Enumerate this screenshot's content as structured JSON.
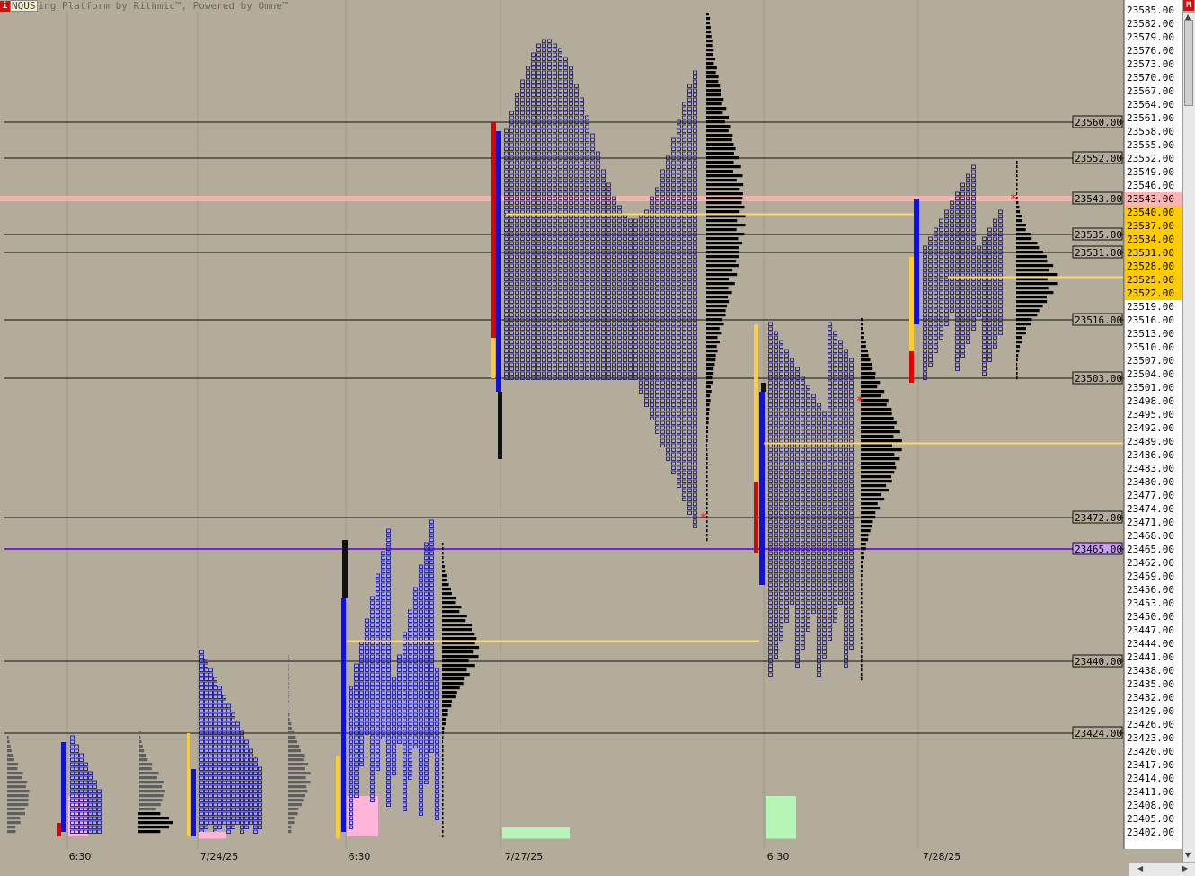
{
  "header": {
    "badge_left": "i",
    "symbol": "NQUS",
    "title": "ing Platform by Rithmic™, Powered by Omne™",
    "badge_right": "M"
  },
  "x_axis": [
    "6:30",
    "7/24/25",
    "6:30",
    "7/27/25",
    "6:30",
    "7/28/25"
  ],
  "price_ticks": [
    "23585.00",
    "23582.00",
    "23579.00",
    "23576.00",
    "23573.00",
    "23570.00",
    "23567.00",
    "23564.00",
    "23561.00",
    "23558.00",
    "23555.00",
    "23552.00",
    "23549.00",
    "23546.00",
    "23543.00",
    "23540.00",
    "23537.00",
    "23534.00",
    "23531.00",
    "23528.00",
    "23525.00",
    "23522.00",
    "23519.00",
    "23516.00",
    "23513.00",
    "23510.00",
    "23507.00",
    "23504.00",
    "23501.00",
    "23498.00",
    "23495.00",
    "23492.00",
    "23489.00",
    "23486.00",
    "23483.00",
    "23480.00",
    "23477.00",
    "23474.00",
    "23471.00",
    "23468.00",
    "23465.00",
    "23462.00",
    "23459.00",
    "23456.00",
    "23453.00",
    "23450.00",
    "23447.00",
    "23444.00",
    "23441.00",
    "23438.00",
    "23435.00",
    "23432.00",
    "23429.00",
    "23426.00",
    "23423.00",
    "23420.00",
    "23417.00",
    "23414.00",
    "23411.00",
    "23408.00",
    "23405.00",
    "23402.00"
  ],
  "colors": {
    "background": "#b3ac9a",
    "poc": "#ffd966",
    "tpo": "#1a1aaa",
    "profile": "#000000",
    "profile_prior": "#5f5f5f",
    "ib_blue": "#1111dd",
    "ib_red": "#e00000",
    "ib_yellow": "#ffcc33",
    "vpoc_purple": "#7a1ee0",
    "current_price": "#ffb4b4",
    "star": "#ff0000"
  },
  "chart_data": {
    "type": "market-profile",
    "symbol": "NQUS",
    "x_labels": [
      "6:30",
      "7/24/25",
      "6:30",
      "7/27/25",
      "6:30",
      "7/28/25"
    ],
    "y_range": [
      23400.5,
      23587
    ],
    "level_lines": [
      {
        "price": 23560.0,
        "label": "23560.00"
      },
      {
        "price": 23552.0,
        "label": "23552.00"
      },
      {
        "price": 23535.0,
        "label": "23535.00"
      },
      {
        "price": 23531.0,
        "label": "23531.00"
      },
      {
        "price": 23516.0,
        "label": "23516.00"
      },
      {
        "price": 23503.0,
        "label": "23503.00"
      },
      {
        "price": 23472.0,
        "label": "23472.00"
      },
      {
        "price": 23440.0,
        "label": "23440.00"
      },
      {
        "price": 23424.0,
        "label": "23424.00"
      }
    ],
    "highlighted_levels": [
      {
        "price": 23543.0,
        "label": "23543.00",
        "kind": "last"
      },
      {
        "price": 23465.0,
        "label": "23465.00",
        "kind": "naked-vpoc"
      }
    ],
    "poc_lines": [
      23539.5,
      23444.5,
      23488.5,
      23525.5
    ],
    "value_area_labels": [
      "23540.00",
      "23537.00",
      "23534.00",
      "23531.00",
      "23528.00",
      "23525.00",
      "23522.00"
    ],
    "sessions": [
      {
        "x_label": "6:30",
        "tpo_range": [
          23403,
          23424
        ],
        "profile_peak": 23420
      },
      {
        "x_label": "7/24/25",
        "tpo_range": [
          23403,
          23444
        ],
        "profile_peak": 23415
      },
      {
        "x_label": "6:30",
        "tpo_range": [
          23403,
          23472
        ],
        "profile_peak": 23445
      },
      {
        "x_label": "7/27/25",
        "tpo_range": [
          23467,
          23585
        ],
        "profile_peak": 23540
      },
      {
        "x_label": "6:30",
        "tpo_range": [
          23436,
          23532
        ],
        "profile_peak": 23488
      },
      {
        "x_label": "7/28/25",
        "tpo_range": [
          23503,
          23552
        ],
        "profile_peak": 23525
      }
    ]
  }
}
